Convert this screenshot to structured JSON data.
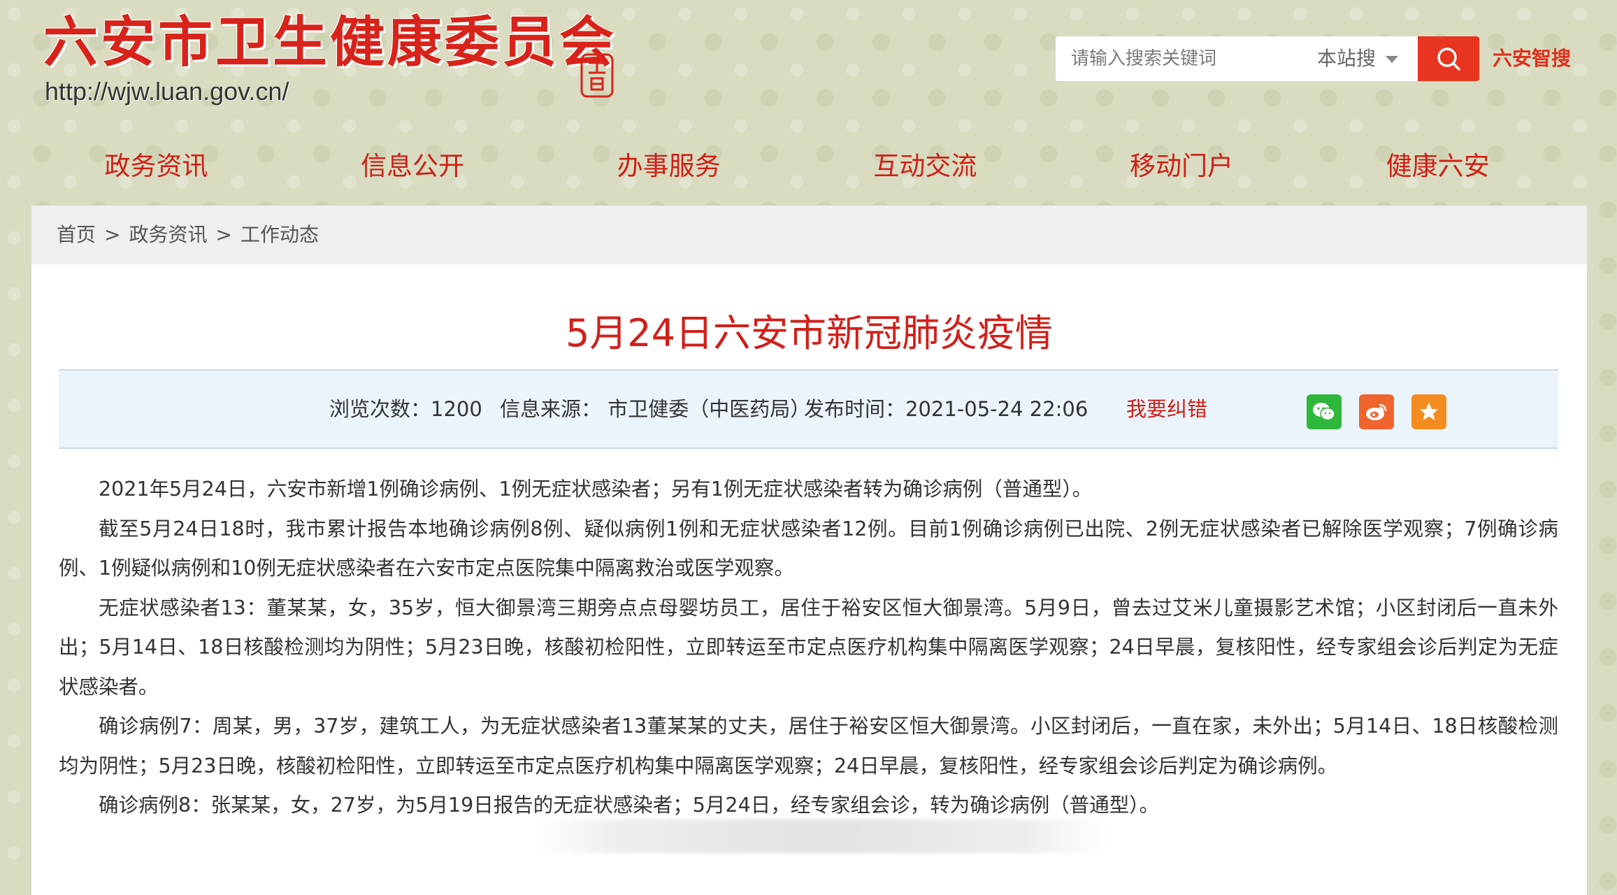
{
  "header": {
    "site_title": "六安市卫生健康委员会",
    "site_url": "http://wjw.luan.gov.cn/",
    "search": {
      "placeholder": "请输入搜索关键词",
      "scope": "本站搜",
      "icon": "search-icon"
    },
    "smart_search_label": "六安智搜"
  },
  "nav": {
    "items": [
      {
        "label": "政务资讯"
      },
      {
        "label": "信息公开"
      },
      {
        "label": "办事服务"
      },
      {
        "label": "互动交流"
      },
      {
        "label": "移动门户"
      },
      {
        "label": "健康六安"
      }
    ]
  },
  "breadcrumb": {
    "items": [
      "首页",
      "政务资讯",
      "工作动态"
    ],
    "separator": ">"
  },
  "article": {
    "title": "5月24日六安市新冠肺炎疫情",
    "meta": {
      "views": "浏览次数：1200",
      "source": "信息来源：  市卫健委（中医药局）",
      "publish_time": "发布时间：2021-05-24 22:06",
      "correction_link": "我要纠错"
    },
    "share": {
      "wechat_icon": "wechat-icon",
      "weibo_icon": "weibo-icon",
      "favorite_icon": "star-icon"
    },
    "paragraphs": [
      "2021年5月24日，六安市新增1例确诊病例、1例无症状感染者；另有1例无症状感染者转为确诊病例（普通型）。",
      "截至5月24日18时，我市累计报告本地确诊病例8例、疑似病例1例和无症状感染者12例。目前1例确诊病例已出院、2例无症状感染者已解除医学观察；7例确诊病例、1例疑似病例和10例无症状感染者在六安市定点医院集中隔离救治或医学观察。",
      "无症状感染者13：董某某，女，35岁，恒大御景湾三期旁点点母婴坊员工，居住于裕安区恒大御景湾。5月9日，曾去过艾米儿童摄影艺术馆；小区封闭后一直未外出；5月14日、18日核酸检测均为阴性；5月23日晚，核酸初检阳性，立即转运至市定点医疗机构集中隔离医学观察；24日早晨，复核阳性，经专家组会诊后判定为无症状感染者。",
      "确诊病例7：周某，男，37岁，建筑工人，为无症状感染者13董某某的丈夫，居住于裕安区恒大御景湾。小区封闭后，一直在家，未外出；5月14日、18日核酸检测均为阴性；5月23日晚，核酸初检阳性，立即转运至市定点医疗机构集中隔离医学观察；24日早晨，复核阳性，经专家组会诊后判定为确诊病例。",
      "确诊病例8：张某某，女，27岁，为5月19日报告的无症状感染者；5月24日，经专家组会诊，转为确诊病例（普通型）。"
    ]
  },
  "colors": {
    "brand_red": "#d8231a",
    "search_button": "#e8351f",
    "meta_background": "#ebf4fa",
    "page_background": "#d9dcc0"
  }
}
